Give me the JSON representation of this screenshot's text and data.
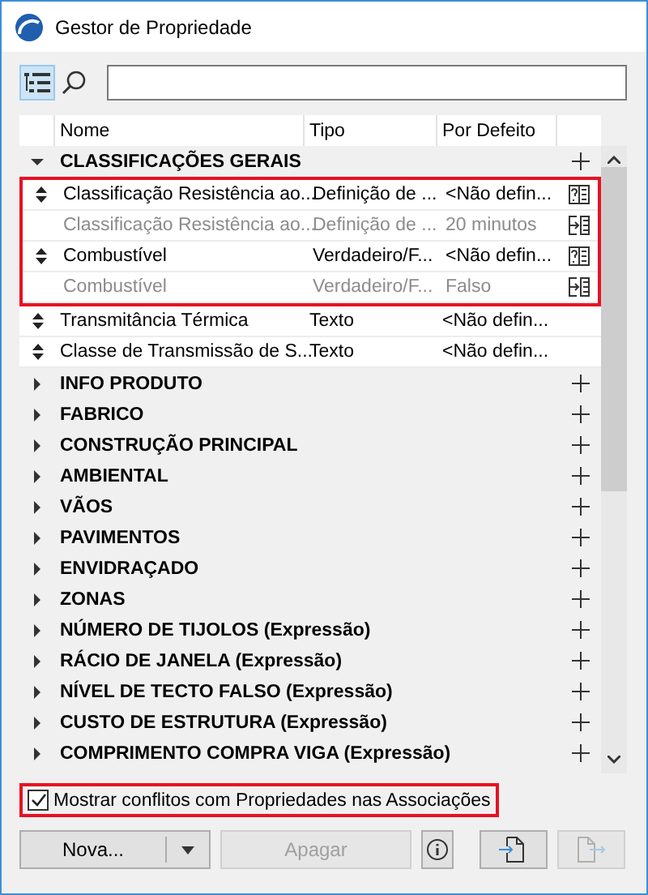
{
  "window": {
    "title": "Gestor de Propriedade"
  },
  "toolbar": {
    "tree_view_selected": true
  },
  "table": {
    "columns": [
      "Nome",
      "Tipo",
      "Por Defeito"
    ],
    "categories": [
      {
        "name": "CLASSIFICAÇÕES GERAIS",
        "expanded": true,
        "items": [
          {
            "kind": "conflict",
            "highlighted": true,
            "name": "Classificação Resistência ao...",
            "type": "Definição de ...",
            "default": "<Não defin..."
          },
          {
            "kind": "inherited",
            "highlighted": true,
            "name": "Classificação Resistência ao...",
            "type": "Definição de ...",
            "default": "20 minutos"
          },
          {
            "kind": "conflict",
            "highlighted": true,
            "name": "Combustível",
            "type": "Verdadeiro/F...",
            "default": "<Não defin..."
          },
          {
            "kind": "inherited",
            "highlighted": true,
            "name": "Combustível",
            "type": "Verdadeiro/F...",
            "default": "Falso"
          },
          {
            "kind": "property",
            "highlighted": false,
            "name": "Transmitância Térmica",
            "type": "Texto",
            "default": "<Não defin..."
          },
          {
            "kind": "property",
            "highlighted": false,
            "name": "Classe de Transmissão de S...",
            "type": "Texto",
            "default": "<Não defin..."
          }
        ]
      },
      {
        "name": "INFO PRODUTO",
        "expanded": false
      },
      {
        "name": "FABRICO",
        "expanded": false
      },
      {
        "name": "CONSTRUÇÃO PRINCIPAL",
        "expanded": false
      },
      {
        "name": "AMBIENTAL",
        "expanded": false
      },
      {
        "name": "VÃOS",
        "expanded": false
      },
      {
        "name": "PAVIMENTOS",
        "expanded": false
      },
      {
        "name": "ENVIDRAÇADO",
        "expanded": false
      },
      {
        "name": "ZONAS",
        "expanded": false
      },
      {
        "name": "NÚMERO DE TIJOLOS (Expressão)",
        "expanded": false
      },
      {
        "name": "RÁCIO DE JANELA (Expressão)",
        "expanded": false
      },
      {
        "name": "NÍVEL DE TECTO FALSO (Expressão)",
        "expanded": false
      },
      {
        "name": "CUSTO DE ESTRUTURA (Expressão)",
        "expanded": false
      },
      {
        "name": "COMPRIMENTO COMPRA VIGA (Expressão)",
        "expanded": false
      }
    ]
  },
  "conflicts_option": {
    "label": "Mostrar conflitos com Propriedades nas Associações",
    "checked": true,
    "highlighted": true
  },
  "buttons": [
    {
      "kind": "split",
      "label": "Nova...",
      "disabled": false
    },
    {
      "kind": "text",
      "label": "Apagar",
      "disabled": true
    },
    {
      "kind": "info",
      "disabled": false
    },
    {
      "kind": "import",
      "disabled": false
    },
    {
      "kind": "export",
      "disabled": true
    }
  ]
}
